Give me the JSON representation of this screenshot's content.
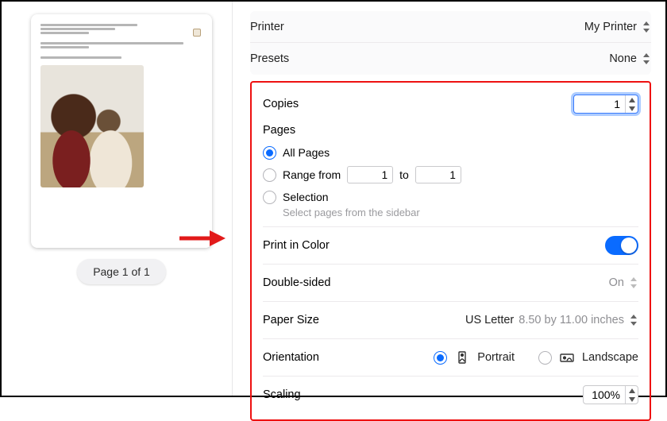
{
  "preview": {
    "page_indicator": "Page 1 of 1"
  },
  "top": {
    "printer_label": "Printer",
    "printer_value": "My Printer",
    "presets_label": "Presets",
    "presets_value": "None"
  },
  "copies": {
    "label": "Copies",
    "value": "1"
  },
  "pages": {
    "label": "Pages",
    "all": "All Pages",
    "range_label": "Range from",
    "range_from": "1",
    "range_to_label": "to",
    "range_to": "1",
    "selection": "Selection",
    "selection_hint": "Select pages from the sidebar"
  },
  "color": {
    "label": "Print in Color",
    "on": true
  },
  "double": {
    "label": "Double-sided",
    "value": "On"
  },
  "paper": {
    "label": "Paper Size",
    "value": "US Letter",
    "dims": "8.50 by 11.00 inches"
  },
  "orientation": {
    "label": "Orientation",
    "portrait": "Portrait",
    "landscape": "Landscape"
  },
  "scaling": {
    "label": "Scaling",
    "value": "100%"
  }
}
